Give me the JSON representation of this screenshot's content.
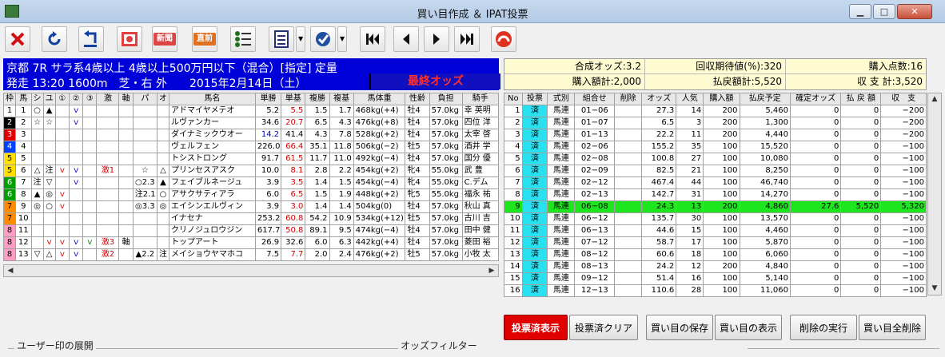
{
  "window": {
    "title": "買い目作成 ＆ IPAT投票",
    "min": "▁",
    "max": "□",
    "close": "✕"
  },
  "toolbar": {
    "icons": [
      "close-x-icon",
      "refresh-icon",
      "back-arrow-icon",
      "odds-screen-icon",
      "new-icon",
      "direct-icon",
      "list-icon",
      "checklist-icon",
      "vote-icon"
    ],
    "new_label": "新聞",
    "direct_label": "直前"
  },
  "race": {
    "line1": "京都 7R サラ系4歳以上 4歳以上500万円以下（混合）[指定] 定量",
    "line2": "発走 13:20 1600m　芝・右 外　　2015年2月14日（土）",
    "final_odds": "最終オッズ"
  },
  "summary": {
    "combined_odds": "合成オッズ:3.2",
    "expected_value": "回収期待値(%):320",
    "points": "購入点数:16",
    "purchase_total": "購入額計:2,000",
    "refund_total": "払戻額計:5,520",
    "balance": "収 支 計:3,520"
  },
  "horses_table": {
    "headers": [
      "枠",
      "馬",
      "シ",
      "ユ",
      "①",
      "②",
      "③",
      "激",
      "軸",
      "パ",
      "オ",
      "馬名",
      "単勝",
      "単基",
      "複勝",
      "複基",
      "馬体重",
      "性齢",
      "負担",
      "騎手"
    ],
    "rows": [
      [
        "1",
        "1",
        "○",
        "▲",
        "",
        "ｖ",
        "",
        "",
        "",
        "",
        "",
        "アドマイヤメテオ",
        "5.2",
        "5.5",
        "1.5",
        "1.7",
        "468kg(+4)",
        "牡4",
        "57.0kg",
        "幸 英明"
      ],
      [
        "2",
        "2",
        "☆",
        "☆",
        "",
        "ｖ",
        "",
        "",
        "",
        "",
        "",
        "ルヴァンカー",
        "34.6",
        "20.7",
        "6.5",
        "4.3",
        "476kg(+8)",
        "牡4",
        "57.0kg",
        "四位 洋"
      ],
      [
        "3",
        "3",
        "",
        "",
        "",
        "",
        "",
        "",
        "",
        "",
        "",
        "ダイナミックウオー",
        "14.2",
        "41.4",
        "4.3",
        "7.8",
        "528kg(+2)",
        "牡4",
        "57.0kg",
        "太宰 啓"
      ],
      [
        "4",
        "4",
        "",
        "",
        "",
        "",
        "",
        "",
        "",
        "",
        "",
        "ヴェルフェン",
        "226.0",
        "66.4",
        "35.1",
        "11.8",
        "506kg(−2)",
        "牡5",
        "57.0kg",
        "酒井 学"
      ],
      [
        "5",
        "5",
        "",
        "",
        "",
        "",
        "",
        "",
        "",
        "",
        "",
        "トシストロング",
        "91.7",
        "61.5",
        "11.7",
        "11.0",
        "492kg(−4)",
        "牡4",
        "57.0kg",
        "国分 優"
      ],
      [
        "5",
        "6",
        "△",
        "注",
        "ｖ",
        "ｖ",
        "",
        "激1",
        "",
        "☆",
        "△",
        "プリンセスアスク",
        "10.0",
        "8.1",
        "2.8",
        "2.2",
        "454kg(+2)",
        "牝4",
        "55.0kg",
        "武 豊"
      ],
      [
        "6",
        "7",
        "注",
        "▽",
        "",
        "ｖ",
        "",
        "",
        "",
        "○2.3",
        "▲",
        "フェイブルネージュ",
        "3.9",
        "3.5",
        "1.4",
        "1.5",
        "454kg(−4)",
        "牝4",
        "55.0kg",
        "C.デム"
      ],
      [
        "6",
        "8",
        "▲",
        "◎",
        "ｖ",
        "",
        "",
        "",
        "",
        "注2.1",
        "○",
        "アサクサティアラ",
        "6.0",
        "6.5",
        "1.5",
        "1.9",
        "448kg(+2)",
        "牝5",
        "55.0kg",
        "福永 祐"
      ],
      [
        "7",
        "9",
        "◎",
        "○",
        "ｖ",
        "",
        "",
        "",
        "",
        "◎3.3",
        "◎",
        "エイシンエルヴィン",
        "3.9",
        "3.0",
        "1.4",
        "1.4",
        "504kg(0)",
        "牡4",
        "57.0kg",
        "秋山 真"
      ],
      [
        "7",
        "10",
        "",
        "",
        "",
        "",
        "",
        "",
        "",
        "",
        "",
        "イナセナ",
        "253.2",
        "60.8",
        "54.2",
        "10.9",
        "534kg(+12)",
        "牡5",
        "57.0kg",
        "古川 吉"
      ],
      [
        "8",
        "11",
        "",
        "",
        "",
        "",
        "",
        "",
        "",
        "",
        "",
        "クリノジュロウジン",
        "617.7",
        "50.8",
        "89.1",
        "9.5",
        "474kg(−4)",
        "牡4",
        "57.0kg",
        "田中 健"
      ],
      [
        "8",
        "12",
        "",
        "ｖ",
        "ｖ",
        "ｖ",
        "ｖ",
        "激3",
        "軸",
        "",
        "",
        "トップアート",
        "26.9",
        "32.6",
        "6.0",
        "6.3",
        "442kg(+4)",
        "牡4",
        "57.0kg",
        "菱田 裕"
      ],
      [
        "8",
        "13",
        "▽",
        "△",
        "ｖ",
        "ｖ",
        "",
        "激2",
        "",
        "▲2.2",
        "注",
        "メイショウヤマホコ",
        "7.5",
        "7.7",
        "2.0",
        "2.4",
        "476kg(+2)",
        "牡5",
        "57.0kg",
        "小牧 太"
      ]
    ]
  },
  "bets_table": {
    "headers": [
      "No",
      "投票",
      "式別",
      "組合せ",
      "削除",
      "オッズ",
      "人気",
      "購入額",
      "払戻予定",
      "確定オッズ",
      "払 戻 額",
      "収　支"
    ],
    "rows": [
      [
        "1",
        "済",
        "馬連",
        "01−06",
        "",
        "27.3",
        "14",
        "200",
        "5,460",
        "0",
        "0",
        "−200"
      ],
      [
        "2",
        "済",
        "馬連",
        "01−07",
        "",
        "6.5",
        "3",
        "200",
        "1,300",
        "0",
        "0",
        "−200"
      ],
      [
        "3",
        "済",
        "馬連",
        "01−13",
        "",
        "22.2",
        "11",
        "200",
        "4,440",
        "0",
        "0",
        "−200"
      ],
      [
        "4",
        "済",
        "馬連",
        "02−06",
        "",
        "155.2",
        "35",
        "100",
        "15,520",
        "0",
        "0",
        "−100"
      ],
      [
        "5",
        "済",
        "馬連",
        "02−08",
        "",
        "100.8",
        "27",
        "100",
        "10,080",
        "0",
        "0",
        "−100"
      ],
      [
        "6",
        "済",
        "馬連",
        "02−09",
        "",
        "82.5",
        "21",
        "100",
        "8,250",
        "0",
        "0",
        "−100"
      ],
      [
        "7",
        "済",
        "馬連",
        "02−12",
        "",
        "467.4",
        "44",
        "100",
        "46,740",
        "0",
        "0",
        "−100"
      ],
      [
        "8",
        "済",
        "馬連",
        "02−13",
        "",
        "142.7",
        "31",
        "100",
        "14,270",
        "0",
        "0",
        "−100"
      ],
      [
        "9",
        "済",
        "馬連",
        "06−08",
        "",
        "24.3",
        "13",
        "200",
        "4,860",
        "27.6",
        "5,520",
        "5,320"
      ],
      [
        "10",
        "済",
        "馬連",
        "06−12",
        "",
        "135.7",
        "30",
        "100",
        "13,570",
        "0",
        "0",
        "−100"
      ],
      [
        "11",
        "済",
        "馬連",
        "06−13",
        "",
        "44.6",
        "15",
        "100",
        "4,460",
        "0",
        "0",
        "−100"
      ],
      [
        "12",
        "済",
        "馬連",
        "07−12",
        "",
        "58.7",
        "17",
        "100",
        "5,870",
        "0",
        "0",
        "−100"
      ],
      [
        "13",
        "済",
        "馬連",
        "08−12",
        "",
        "60.6",
        "18",
        "100",
        "6,060",
        "0",
        "0",
        "−100"
      ],
      [
        "14",
        "済",
        "馬連",
        "08−13",
        "",
        "24.2",
        "12",
        "200",
        "4,840",
        "0",
        "0",
        "−100"
      ],
      [
        "15",
        "済",
        "馬連",
        "09−12",
        "",
        "51.4",
        "16",
        "100",
        "5,140",
        "0",
        "0",
        "−100"
      ],
      [
        "16",
        "済",
        "馬連",
        "12−13",
        "",
        "110.6",
        "28",
        "100",
        "11,060",
        "0",
        "0",
        "−100"
      ]
    ]
  },
  "buttons": {
    "show_voted": "投票済表示",
    "clear_voted": "投票済クリア",
    "save_bets": "買い目の保存",
    "show_bets": "買い目の表示",
    "execute_delete": "削除の実行",
    "delete_all": "買い目全削除"
  },
  "sections": {
    "user_marks": "ユーザー印の展開",
    "odds_filter": "オッズフィルター"
  },
  "colors": {
    "race_header": "#0000d8",
    "highlight_row": "#1ee61e",
    "voted_cell": "#29e0f0",
    "waku": [
      "#ffffff",
      "#000000",
      "#e00000",
      "#0040ff",
      "#ffe000",
      "#00a000",
      "#ff8c00",
      "#ff9ec4"
    ]
  }
}
